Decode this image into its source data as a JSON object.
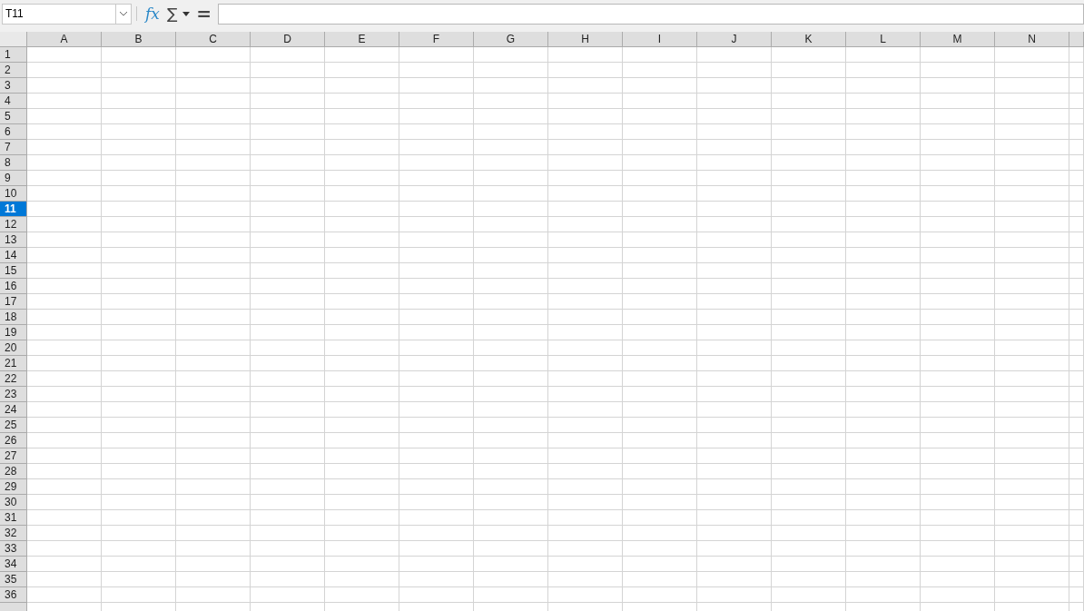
{
  "formula_bar": {
    "name_box": "T11",
    "function_wizard": "fx",
    "sum_symbol": "∑",
    "equals_symbol": "="
  },
  "sheet": {
    "columns": [
      {
        "label": "A",
        "selected": false
      },
      {
        "label": "B",
        "selected": false
      },
      {
        "label": "C",
        "selected": false
      },
      {
        "label": "D",
        "selected": false
      },
      {
        "label": "E",
        "selected": false
      },
      {
        "label": "F",
        "selected": false
      },
      {
        "label": "G",
        "selected": false
      },
      {
        "label": "H",
        "selected": false
      },
      {
        "label": "I",
        "selected": false
      },
      {
        "label": "J",
        "selected": false
      },
      {
        "label": "K",
        "selected": false
      },
      {
        "label": "L",
        "selected": false
      },
      {
        "label": "M",
        "selected": false
      },
      {
        "label": "N",
        "selected": false
      }
    ],
    "rows": [
      {
        "label": "1",
        "selected": false
      },
      {
        "label": "2",
        "selected": false
      },
      {
        "label": "3",
        "selected": false
      },
      {
        "label": "4",
        "selected": false
      },
      {
        "label": "5",
        "selected": false
      },
      {
        "label": "6",
        "selected": false
      },
      {
        "label": "7",
        "selected": false
      },
      {
        "label": "8",
        "selected": false
      },
      {
        "label": "9",
        "selected": false
      },
      {
        "label": "10",
        "selected": false
      },
      {
        "label": "11",
        "selected": true
      },
      {
        "label": "12",
        "selected": false
      },
      {
        "label": "13",
        "selected": false
      },
      {
        "label": "14",
        "selected": false
      },
      {
        "label": "15",
        "selected": false
      },
      {
        "label": "16",
        "selected": false
      },
      {
        "label": "17",
        "selected": false
      },
      {
        "label": "18",
        "selected": false
      },
      {
        "label": "19",
        "selected": false
      },
      {
        "label": "20",
        "selected": false
      },
      {
        "label": "21",
        "selected": false
      },
      {
        "label": "22",
        "selected": false
      },
      {
        "label": "23",
        "selected": false
      },
      {
        "label": "24",
        "selected": false
      },
      {
        "label": "25",
        "selected": false
      },
      {
        "label": "26",
        "selected": false
      },
      {
        "label": "27",
        "selected": false
      },
      {
        "label": "28",
        "selected": false
      },
      {
        "label": "29",
        "selected": false
      },
      {
        "label": "30",
        "selected": false
      },
      {
        "label": "31",
        "selected": false
      },
      {
        "label": "32",
        "selected": false
      },
      {
        "label": "33",
        "selected": false
      },
      {
        "label": "34",
        "selected": false
      },
      {
        "label": "35",
        "selected": false
      },
      {
        "label": "36",
        "selected": false
      }
    ]
  }
}
